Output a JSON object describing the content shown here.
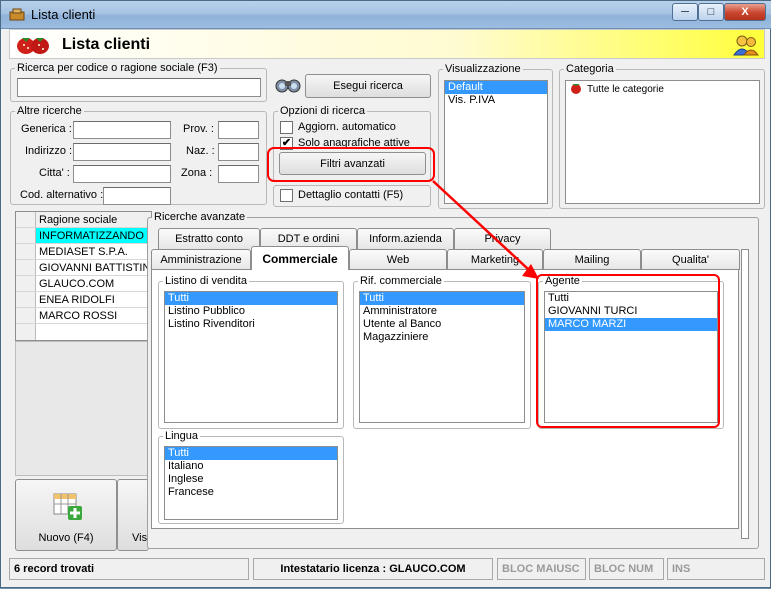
{
  "window": {
    "title": "Lista clienti",
    "minimize": "─",
    "maximize": "□",
    "close": "X"
  },
  "header": {
    "title": "Lista clienti"
  },
  "search_code": {
    "legend": "Ricerca per codice o ragione sociale (F3)",
    "value": "",
    "button": "Esegui ricerca"
  },
  "other_search": {
    "legend": "Altre ricerche",
    "generica": "Generica :",
    "indirizzo": "Indirizzo :",
    "citta": "Citta' :",
    "prov": "Prov. :",
    "naz": "Naz. :",
    "zona": "Zona :",
    "cod_alt": "Cod. alternativo :"
  },
  "options": {
    "legend": "Opzioni di ricerca",
    "auto_update": "Aggiorn. automatico",
    "auto_update_checked": false,
    "only_active": "Solo anagrafiche attive",
    "only_active_checked": true,
    "filters_button": "Filtri avanzati",
    "contact_detail": "Dettaglio contatti (F5)",
    "contact_detail_checked": false
  },
  "view": {
    "legend": "Visualizzazione",
    "items": [
      "Default",
      "Vis. P.IVA"
    ],
    "selected": "Default"
  },
  "category": {
    "legend": "Categoria",
    "items": [
      "Tutte le categorie"
    ]
  },
  "grid": {
    "header": "Ragione sociale",
    "rows": [
      "INFORMATIZZANDO S",
      "MEDIASET S.P.A.",
      "GIOVANNI BATTISTIN",
      "GLAUCO.COM",
      "ENEA RIDOLFI",
      "MARCO ROSSI"
    ],
    "selected_row": 0
  },
  "advanced": {
    "legend": "Ricerche avanzate",
    "tabs_back": [
      "Estratto conto",
      "DDT e ordini",
      "Inform.azienda",
      "Privacy"
    ],
    "tabs_front": [
      "Amministrazione",
      "Commerciale",
      "Web",
      "Marketing",
      "Mailing",
      "Qualita'"
    ],
    "active_tab": "Commerciale",
    "listino": {
      "legend": "Listino di vendita",
      "items": [
        "Tutti",
        "Listino Pubblico",
        "Listino Rivenditori"
      ],
      "selected": 0
    },
    "rif": {
      "legend": "Rif. commerciale",
      "items": [
        "Tutti",
        "Amministratore",
        "Utente al Banco",
        "Magazziniere"
      ],
      "selected": 0
    },
    "agente": {
      "legend": "Agente",
      "items": [
        "Tutti",
        "GIOVANNI TURCI",
        "MARCO MARZI"
      ],
      "selected": 2
    },
    "lingua": {
      "legend": "Lingua",
      "items": [
        "Tutti",
        "Italiano",
        "Inglese",
        "Francese"
      ],
      "selected": 0
    }
  },
  "bottom_buttons": {
    "new": "Nuovo (F4)",
    "view_partial": "Vis"
  },
  "status": {
    "records": "6 record trovati",
    "license": "Intestatario licenza : GLAUCO.COM",
    "caps": "BLOC MAIUSC",
    "num": "BLOC NUM",
    "ins": "INS"
  },
  "colors": {
    "selection": "#3399ff",
    "grid_selection": "#00ffff",
    "annotation": "#ff0000"
  }
}
